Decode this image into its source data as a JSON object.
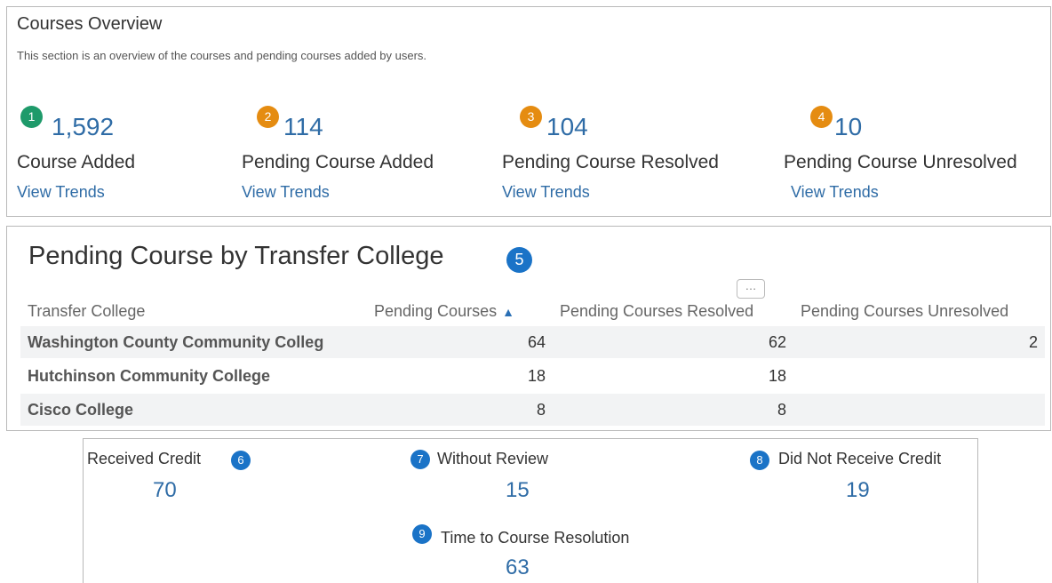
{
  "overview": {
    "title": "Courses Overview",
    "subtitle": "This section is an overview of the courses and pending courses added by users.",
    "stats": [
      {
        "badge": "1",
        "value": "1,592",
        "label": "Course Added",
        "link": "View Trends",
        "badge_color": "#1e9a6a"
      },
      {
        "badge": "2",
        "value": "114",
        "label": "Pending Course Added",
        "link": "View Trends",
        "badge_color": "#e58c11"
      },
      {
        "badge": "3",
        "value": "104",
        "label": "Pending Course Resolved",
        "link": "View Trends",
        "badge_color": "#e58c11"
      },
      {
        "badge": "4",
        "value": "10",
        "label": "Pending Course Unresolved",
        "link": "View Trends",
        "badge_color": "#e58c11"
      }
    ]
  },
  "pending_table": {
    "title": "Pending Course by Transfer College",
    "badge": "5",
    "menu_label": "…",
    "columns": [
      "Transfer College",
      "Pending Courses",
      "Pending Courses Resolved",
      "Pending Courses Unresolved"
    ],
    "rows": [
      [
        "Washington County Community Colleg",
        "64",
        "62",
        "2"
      ],
      [
        "Hutchinson Community College",
        "18",
        "18",
        ""
      ],
      [
        "Cisco College",
        "8",
        "8",
        ""
      ]
    ]
  },
  "credit": {
    "received": {
      "badge": "6",
      "label": "Received Credit",
      "value": "70"
    },
    "without_review": {
      "badge": "7",
      "label": "Without Review",
      "value": "15"
    },
    "not_received": {
      "badge": "8",
      "label": "Did Not Receive Credit",
      "value": "19"
    },
    "resolution": {
      "badge": "9",
      "label": "Time to Course Resolution",
      "value": "63"
    }
  },
  "colors": {
    "accent_blue": "#2f6ca6",
    "badge_green": "#1e9a6a",
    "badge_orange": "#e58c11",
    "badge_blue": "#1a73c7"
  }
}
